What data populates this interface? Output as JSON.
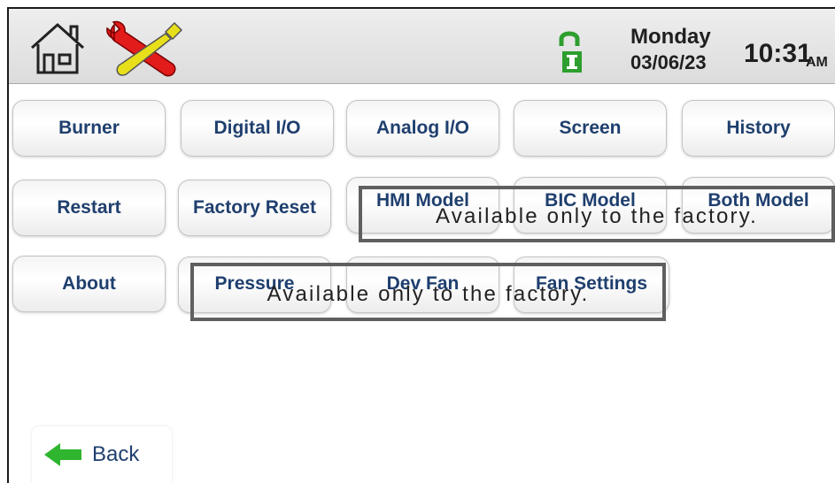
{
  "header": {
    "day": "Monday",
    "date": "03/06/23",
    "time": "10:31",
    "ampm": "AM",
    "icons": [
      "home-icon",
      "settings-tools-icon",
      "lock-icon"
    ]
  },
  "buttons": {
    "burner": "Burner",
    "digital_io": "Digital I/O",
    "analog_io": "Analog I/O",
    "screen": "Screen",
    "history": "History",
    "restart": "Restart",
    "factory_reset": "Factory Reset",
    "hmi_model": "HMI Model",
    "bic_model": "BIC Model",
    "both_model": "Both Model",
    "about": "About",
    "pressure": "Pressure",
    "dev_fan": "Dev Fan",
    "fan_settings": "Fan Settings"
  },
  "overlays": {
    "row2_notice": "Available only to the factory.",
    "row3_notice": "Available only to the factory."
  },
  "footer": {
    "back_label": "Back"
  },
  "colors": {
    "button_text": "#1f3f6e",
    "lock_green": "#2e9e2e",
    "tool_red": "#e21b1b",
    "tool_yellow": "#e6df1a",
    "back_arrow": "#2fb52f"
  }
}
